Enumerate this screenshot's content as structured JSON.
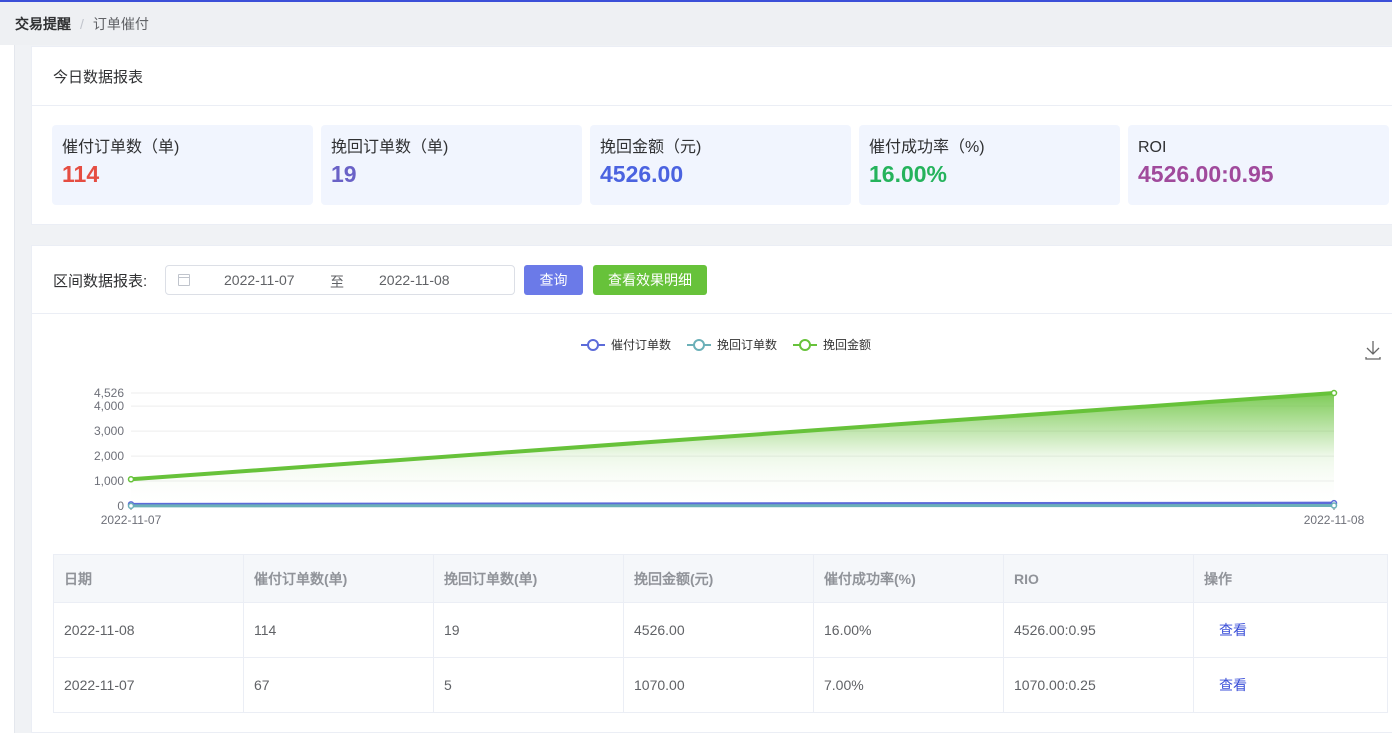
{
  "breadcrumb": {
    "first": "交易提醒",
    "separator": "/",
    "second": "订单催付"
  },
  "today": {
    "title": "今日数据报表",
    "stats": [
      {
        "label": "催付订单数（单)",
        "value": "114",
        "color": "#e54d42"
      },
      {
        "label": "挽回订单数（单)",
        "value": "19",
        "color": "#6a62c7"
      },
      {
        "label": "挽回金额（元)",
        "value": "4526.00",
        "color": "#4b63e0"
      },
      {
        "label": "催付成功率（%)",
        "value": "16.00%",
        "color": "#25b35c"
      },
      {
        "label": "ROI",
        "value": "4526.00:0.95",
        "color": "#a04a9c"
      }
    ]
  },
  "range": {
    "label": "区间数据报表:",
    "start_date": "2022-11-07",
    "separator": "至",
    "end_date": "2022-11-08",
    "query_label": "查询",
    "detail_label": "查看效果明细"
  },
  "chart_data": {
    "type": "line",
    "x": [
      "2022-11-07",
      "2022-11-08"
    ],
    "series": [
      {
        "name": "催付订单数",
        "values": [
          67,
          114
        ],
        "color": "#5c6bd9"
      },
      {
        "name": "挽回订单数",
        "values": [
          5,
          19
        ],
        "color": "#6bb0b8"
      },
      {
        "name": "挽回金额",
        "values": [
          1070,
          4526
        ],
        "color": "#67c23a",
        "area": true
      }
    ],
    "yticks": [
      0,
      1000,
      2000,
      3000,
      4000,
      4526
    ],
    "ytick_labels": [
      "0",
      "1,000",
      "2,000",
      "3,000",
      "4,000",
      "4,526"
    ],
    "ylim": [
      0,
      4526
    ],
    "legend": "top-center",
    "grid": true,
    "download_icon": "download-icon"
  },
  "table": {
    "headers": [
      "日期",
      "催付订单数(单)",
      "挽回订单数(单)",
      "挽回金额(元)",
      "催付成功率(%)",
      "RIO",
      "操作"
    ],
    "rows": [
      [
        "2022-11-08",
        "114",
        "19",
        "4526.00",
        "16.00%",
        "4526.00:0.95",
        "查看"
      ],
      [
        "2022-11-07",
        "67",
        "5",
        "1070.00",
        "7.00%",
        "1070.00:0.25",
        "查看"
      ]
    ]
  }
}
